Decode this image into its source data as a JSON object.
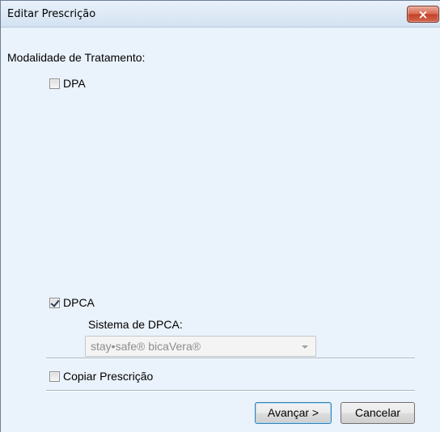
{
  "window": {
    "title": "Editar Prescrição",
    "close_label": "×"
  },
  "form": {
    "modality_label": "Modalidade de Tratamento:",
    "dpa": {
      "label": "DPA",
      "checked": false
    },
    "dpca": {
      "label": "DPCA",
      "checked": true
    },
    "system_label": "Sistema de DPCA:",
    "system_select": {
      "value": "stay•safe® bicaVera®",
      "enabled": false
    },
    "copy_prescription": {
      "label": "Copiar Prescrição",
      "checked": false
    }
  },
  "buttons": {
    "next_label": "Avançar >",
    "cancel_label": "Cancelar"
  }
}
